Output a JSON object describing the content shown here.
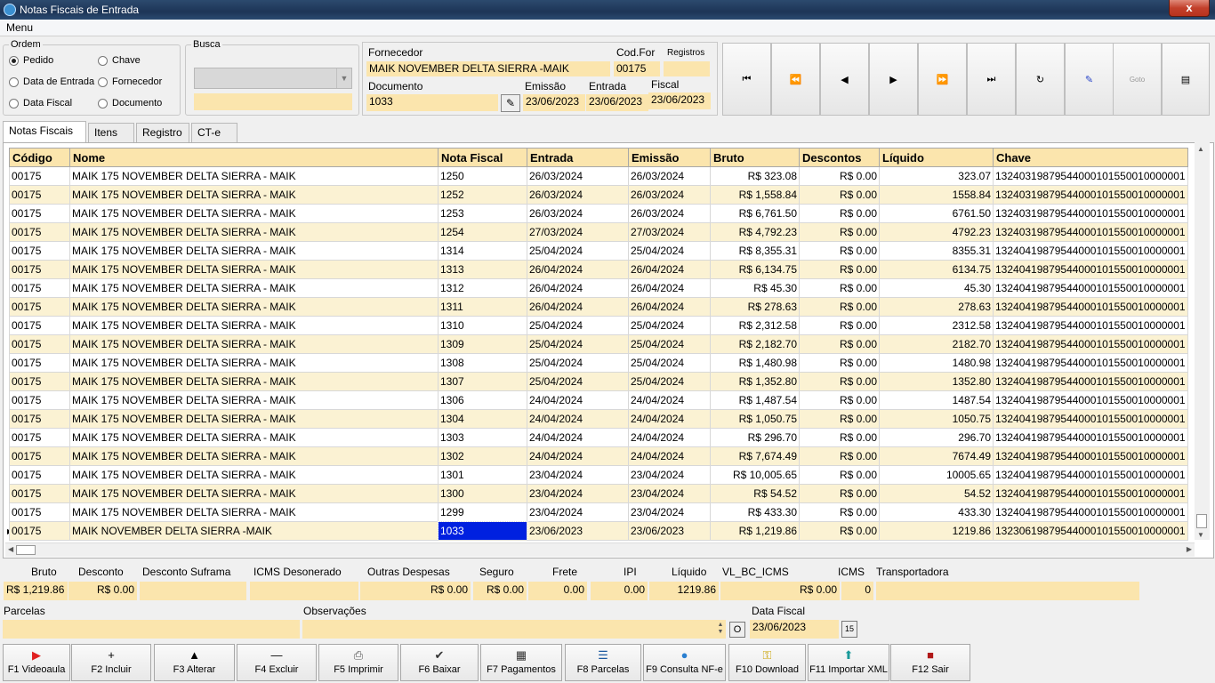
{
  "window": {
    "title": "Notas Fiscais de Entrada",
    "close_label": "x"
  },
  "menu": {
    "label": "Menu"
  },
  "ordem": {
    "legend": "Ordem",
    "options": [
      {
        "label": "Pedido",
        "checked": true
      },
      {
        "label": "Data de Entrada",
        "checked": false
      },
      {
        "label": "Data Fiscal",
        "checked": false
      },
      {
        "label": "Chave",
        "checked": false
      },
      {
        "label": "Fornecedor",
        "checked": false
      },
      {
        "label": "Documento",
        "checked": false
      }
    ]
  },
  "busca": {
    "legend": "Busca",
    "select_value": "",
    "input_value": ""
  },
  "header": {
    "fornecedor_label": "Fornecedor",
    "fornecedor_value": "MAIK NOVEMBER DELTA SIERRA -MAIK",
    "codfor_label": "Cod.For",
    "codfor_value": "00175",
    "registros_label": "Registros",
    "registros_value": "",
    "documento_label": "Documento",
    "documento_value": "1033",
    "emissao_label": "Emissão",
    "emissao_value": "23/06/2023",
    "entrada_label": "Entrada",
    "entrada_value": "23/06/2023",
    "fiscal_label": "Fiscal",
    "fiscal_value": "23/06/2023"
  },
  "nav": [
    {
      "icon": "first-record-icon",
      "glyph": "⏮"
    },
    {
      "icon": "previous-page-icon",
      "glyph": "⏪"
    },
    {
      "icon": "previous-record-icon",
      "glyph": "◀"
    },
    {
      "icon": "next-record-icon",
      "glyph": "▶"
    },
    {
      "icon": "next-page-icon",
      "glyph": "⏩"
    },
    {
      "icon": "last-record-icon",
      "glyph": "⏭"
    },
    {
      "icon": "refresh-icon",
      "glyph": "↻"
    },
    {
      "icon": "edit-tag-icon",
      "glyph": "✎"
    },
    {
      "icon": "goto-icon",
      "glyph": "Goto"
    },
    {
      "icon": "report-icon",
      "glyph": "▤"
    }
  ],
  "tabs": [
    {
      "label": "Notas Fiscais",
      "active": true
    },
    {
      "label": "Itens",
      "active": false
    },
    {
      "label": "Registro",
      "active": false
    },
    {
      "label": "CT-e",
      "active": false
    }
  ],
  "grid": {
    "columns": [
      "Código",
      "Nome",
      "Nota Fiscal",
      "Entrada",
      "Emissão",
      "Bruto",
      "Descontos",
      "Líquido",
      "Chave"
    ],
    "rows": [
      [
        "00175",
        "MAIK 175 NOVEMBER DELTA SIERRA - MAIK",
        "1250",
        "26/03/2024",
        "26/03/2024",
        "R$ 323.08",
        "R$ 0.00",
        "323.07",
        "13240319879544000101550010000001"
      ],
      [
        "00175",
        "MAIK 175 NOVEMBER DELTA SIERRA - MAIK",
        "1252",
        "26/03/2024",
        "26/03/2024",
        "R$ 1,558.84",
        "R$ 0.00",
        "1558.84",
        "13240319879544000101550010000001"
      ],
      [
        "00175",
        "MAIK 175 NOVEMBER DELTA SIERRA - MAIK",
        "1253",
        "26/03/2024",
        "26/03/2024",
        "R$ 6,761.50",
        "R$ 0.00",
        "6761.50",
        "13240319879544000101550010000001"
      ],
      [
        "00175",
        "MAIK 175 NOVEMBER DELTA SIERRA - MAIK",
        "1254",
        "27/03/2024",
        "27/03/2024",
        "R$ 4,792.23",
        "R$ 0.00",
        "4792.23",
        "13240319879544000101550010000001"
      ],
      [
        "00175",
        "MAIK 175 NOVEMBER DELTA SIERRA - MAIK",
        "1314",
        "25/04/2024",
        "25/04/2024",
        "R$ 8,355.31",
        "R$ 0.00",
        "8355.31",
        "13240419879544000101550010000001"
      ],
      [
        "00175",
        "MAIK 175 NOVEMBER DELTA SIERRA - MAIK",
        "1313",
        "26/04/2024",
        "26/04/2024",
        "R$ 6,134.75",
        "R$ 0.00",
        "6134.75",
        "13240419879544000101550010000001"
      ],
      [
        "00175",
        "MAIK 175 NOVEMBER DELTA SIERRA - MAIK",
        "1312",
        "26/04/2024",
        "26/04/2024",
        "R$ 45.30",
        "R$ 0.00",
        "45.30",
        "13240419879544000101550010000001"
      ],
      [
        "00175",
        "MAIK 175 NOVEMBER DELTA SIERRA - MAIK",
        "1311",
        "26/04/2024",
        "26/04/2024",
        "R$ 278.63",
        "R$ 0.00",
        "278.63",
        "13240419879544000101550010000001"
      ],
      [
        "00175",
        "MAIK 175 NOVEMBER DELTA SIERRA - MAIK",
        "1310",
        "25/04/2024",
        "25/04/2024",
        "R$ 2,312.58",
        "R$ 0.00",
        "2312.58",
        "13240419879544000101550010000001"
      ],
      [
        "00175",
        "MAIK 175 NOVEMBER DELTA SIERRA - MAIK",
        "1309",
        "25/04/2024",
        "25/04/2024",
        "R$ 2,182.70",
        "R$ 0.00",
        "2182.70",
        "13240419879544000101550010000001"
      ],
      [
        "00175",
        "MAIK 175 NOVEMBER DELTA SIERRA - MAIK",
        "1308",
        "25/04/2024",
        "25/04/2024",
        "R$ 1,480.98",
        "R$ 0.00",
        "1480.98",
        "13240419879544000101550010000001"
      ],
      [
        "00175",
        "MAIK 175 NOVEMBER DELTA SIERRA - MAIK",
        "1307",
        "25/04/2024",
        "25/04/2024",
        "R$ 1,352.80",
        "R$ 0.00",
        "1352.80",
        "13240419879544000101550010000001"
      ],
      [
        "00175",
        "MAIK 175 NOVEMBER DELTA SIERRA - MAIK",
        "1306",
        "24/04/2024",
        "24/04/2024",
        "R$ 1,487.54",
        "R$ 0.00",
        "1487.54",
        "13240419879544000101550010000001"
      ],
      [
        "00175",
        "MAIK 175 NOVEMBER DELTA SIERRA - MAIK",
        "1304",
        "24/04/2024",
        "24/04/2024",
        "R$ 1,050.75",
        "R$ 0.00",
        "1050.75",
        "13240419879544000101550010000001"
      ],
      [
        "00175",
        "MAIK 175 NOVEMBER DELTA SIERRA - MAIK",
        "1303",
        "24/04/2024",
        "24/04/2024",
        "R$ 296.70",
        "R$ 0.00",
        "296.70",
        "13240419879544000101550010000001"
      ],
      [
        "00175",
        "MAIK 175 NOVEMBER DELTA SIERRA - MAIK",
        "1302",
        "24/04/2024",
        "24/04/2024",
        "R$ 7,674.49",
        "R$ 0.00",
        "7674.49",
        "13240419879544000101550010000001"
      ],
      [
        "00175",
        "MAIK 175 NOVEMBER DELTA SIERRA - MAIK",
        "1301",
        "23/04/2024",
        "23/04/2024",
        "R$ 10,005.65",
        "R$ 0.00",
        "10005.65",
        "13240419879544000101550010000001"
      ],
      [
        "00175",
        "MAIK 175 NOVEMBER DELTA SIERRA - MAIK",
        "1300",
        "23/04/2024",
        "23/04/2024",
        "R$ 54.52",
        "R$ 0.00",
        "54.52",
        "13240419879544000101550010000001"
      ],
      [
        "00175",
        "MAIK 175 NOVEMBER DELTA SIERRA - MAIK",
        "1299",
        "23/04/2024",
        "23/04/2024",
        "R$ 433.30",
        "R$ 0.00",
        "433.30",
        "13240419879544000101550010000001"
      ],
      [
        "00175",
        "MAIK NOVEMBER DELTA SIERRA -MAIK",
        "1033",
        "23/06/2023",
        "23/06/2023",
        "R$ 1,219.86",
        "R$ 0.00",
        "1219.86",
        "13230619879544000101550010000001"
      ]
    ],
    "selected_row": 19
  },
  "totals": {
    "bruto_label": "Bruto",
    "bruto": "R$ 1,219.86",
    "desconto_label": "Desconto",
    "desconto": "R$ 0.00",
    "suframa_label": "Desconto Suframa",
    "suframa": "",
    "icms_deson_label": "ICMS Desonerado",
    "icms_deson": "",
    "outras_label": "Outras Despesas",
    "outras": "R$ 0.00",
    "seguro_label": "Seguro",
    "seguro": "R$ 0.00",
    "frete_label": "Frete",
    "frete": "0.00",
    "ipi_label": "IPI",
    "ipi": "0.00",
    "liquido_label": "Líquido",
    "liquido": "1219.86",
    "vlbc_label": "VL_BC_ICMS",
    "vlbc": "R$ 0.00",
    "icms_label": "ICMS",
    "icms": "0",
    "transp_label": "Transportadora",
    "transp": ""
  },
  "bottom": {
    "parcelas_label": "Parcelas",
    "parcelas": "",
    "obs_label": "Observações",
    "obs": "",
    "obs_btn": "O",
    "datafiscal_label": "Data Fiscal",
    "datafiscal": "23/06/2023",
    "cal_btn": "15"
  },
  "fkeys": [
    {
      "label": "F1 Videoaula",
      "icon": "youtube-icon",
      "glyph": "▶",
      "color": "#e02020"
    },
    {
      "label": "F2 Incluir",
      "icon": "plus-icon",
      "glyph": "+",
      "color": "#000000"
    },
    {
      "label": "F3 Alterar",
      "icon": "up-arrow-icon",
      "glyph": "▲",
      "color": "#000000"
    },
    {
      "label": "F4 Excluir",
      "icon": "minus-icon",
      "glyph": "—",
      "color": "#000000"
    },
    {
      "label": "F5 Imprimir",
      "icon": "printer-icon",
      "glyph": "⎙",
      "color": "#555555"
    },
    {
      "label": "F6 Baixar",
      "icon": "checklist-icon",
      "glyph": "✔",
      "color": "#333333"
    },
    {
      "label": "F7 Pagamentos",
      "icon": "calculator-icon",
      "glyph": "▦",
      "color": "#333333"
    },
    {
      "label": "F8 Parcelas",
      "icon": "list-icon",
      "glyph": "☰",
      "color": "#1e5aa0"
    },
    {
      "label": "F9 Consulta NF-e",
      "icon": "globe-icon",
      "glyph": "●",
      "color": "#2a7fd0"
    },
    {
      "label": "F10 Download",
      "icon": "key-icon",
      "glyph": "⚿",
      "color": "#c9a200"
    },
    {
      "label": "F11 Importar XML",
      "icon": "upload-icon",
      "glyph": "⬆",
      "color": "#1a9a9a"
    },
    {
      "label": "F12 Sair",
      "icon": "exit-door-icon",
      "glyph": "■",
      "color": "#b01818"
    }
  ]
}
